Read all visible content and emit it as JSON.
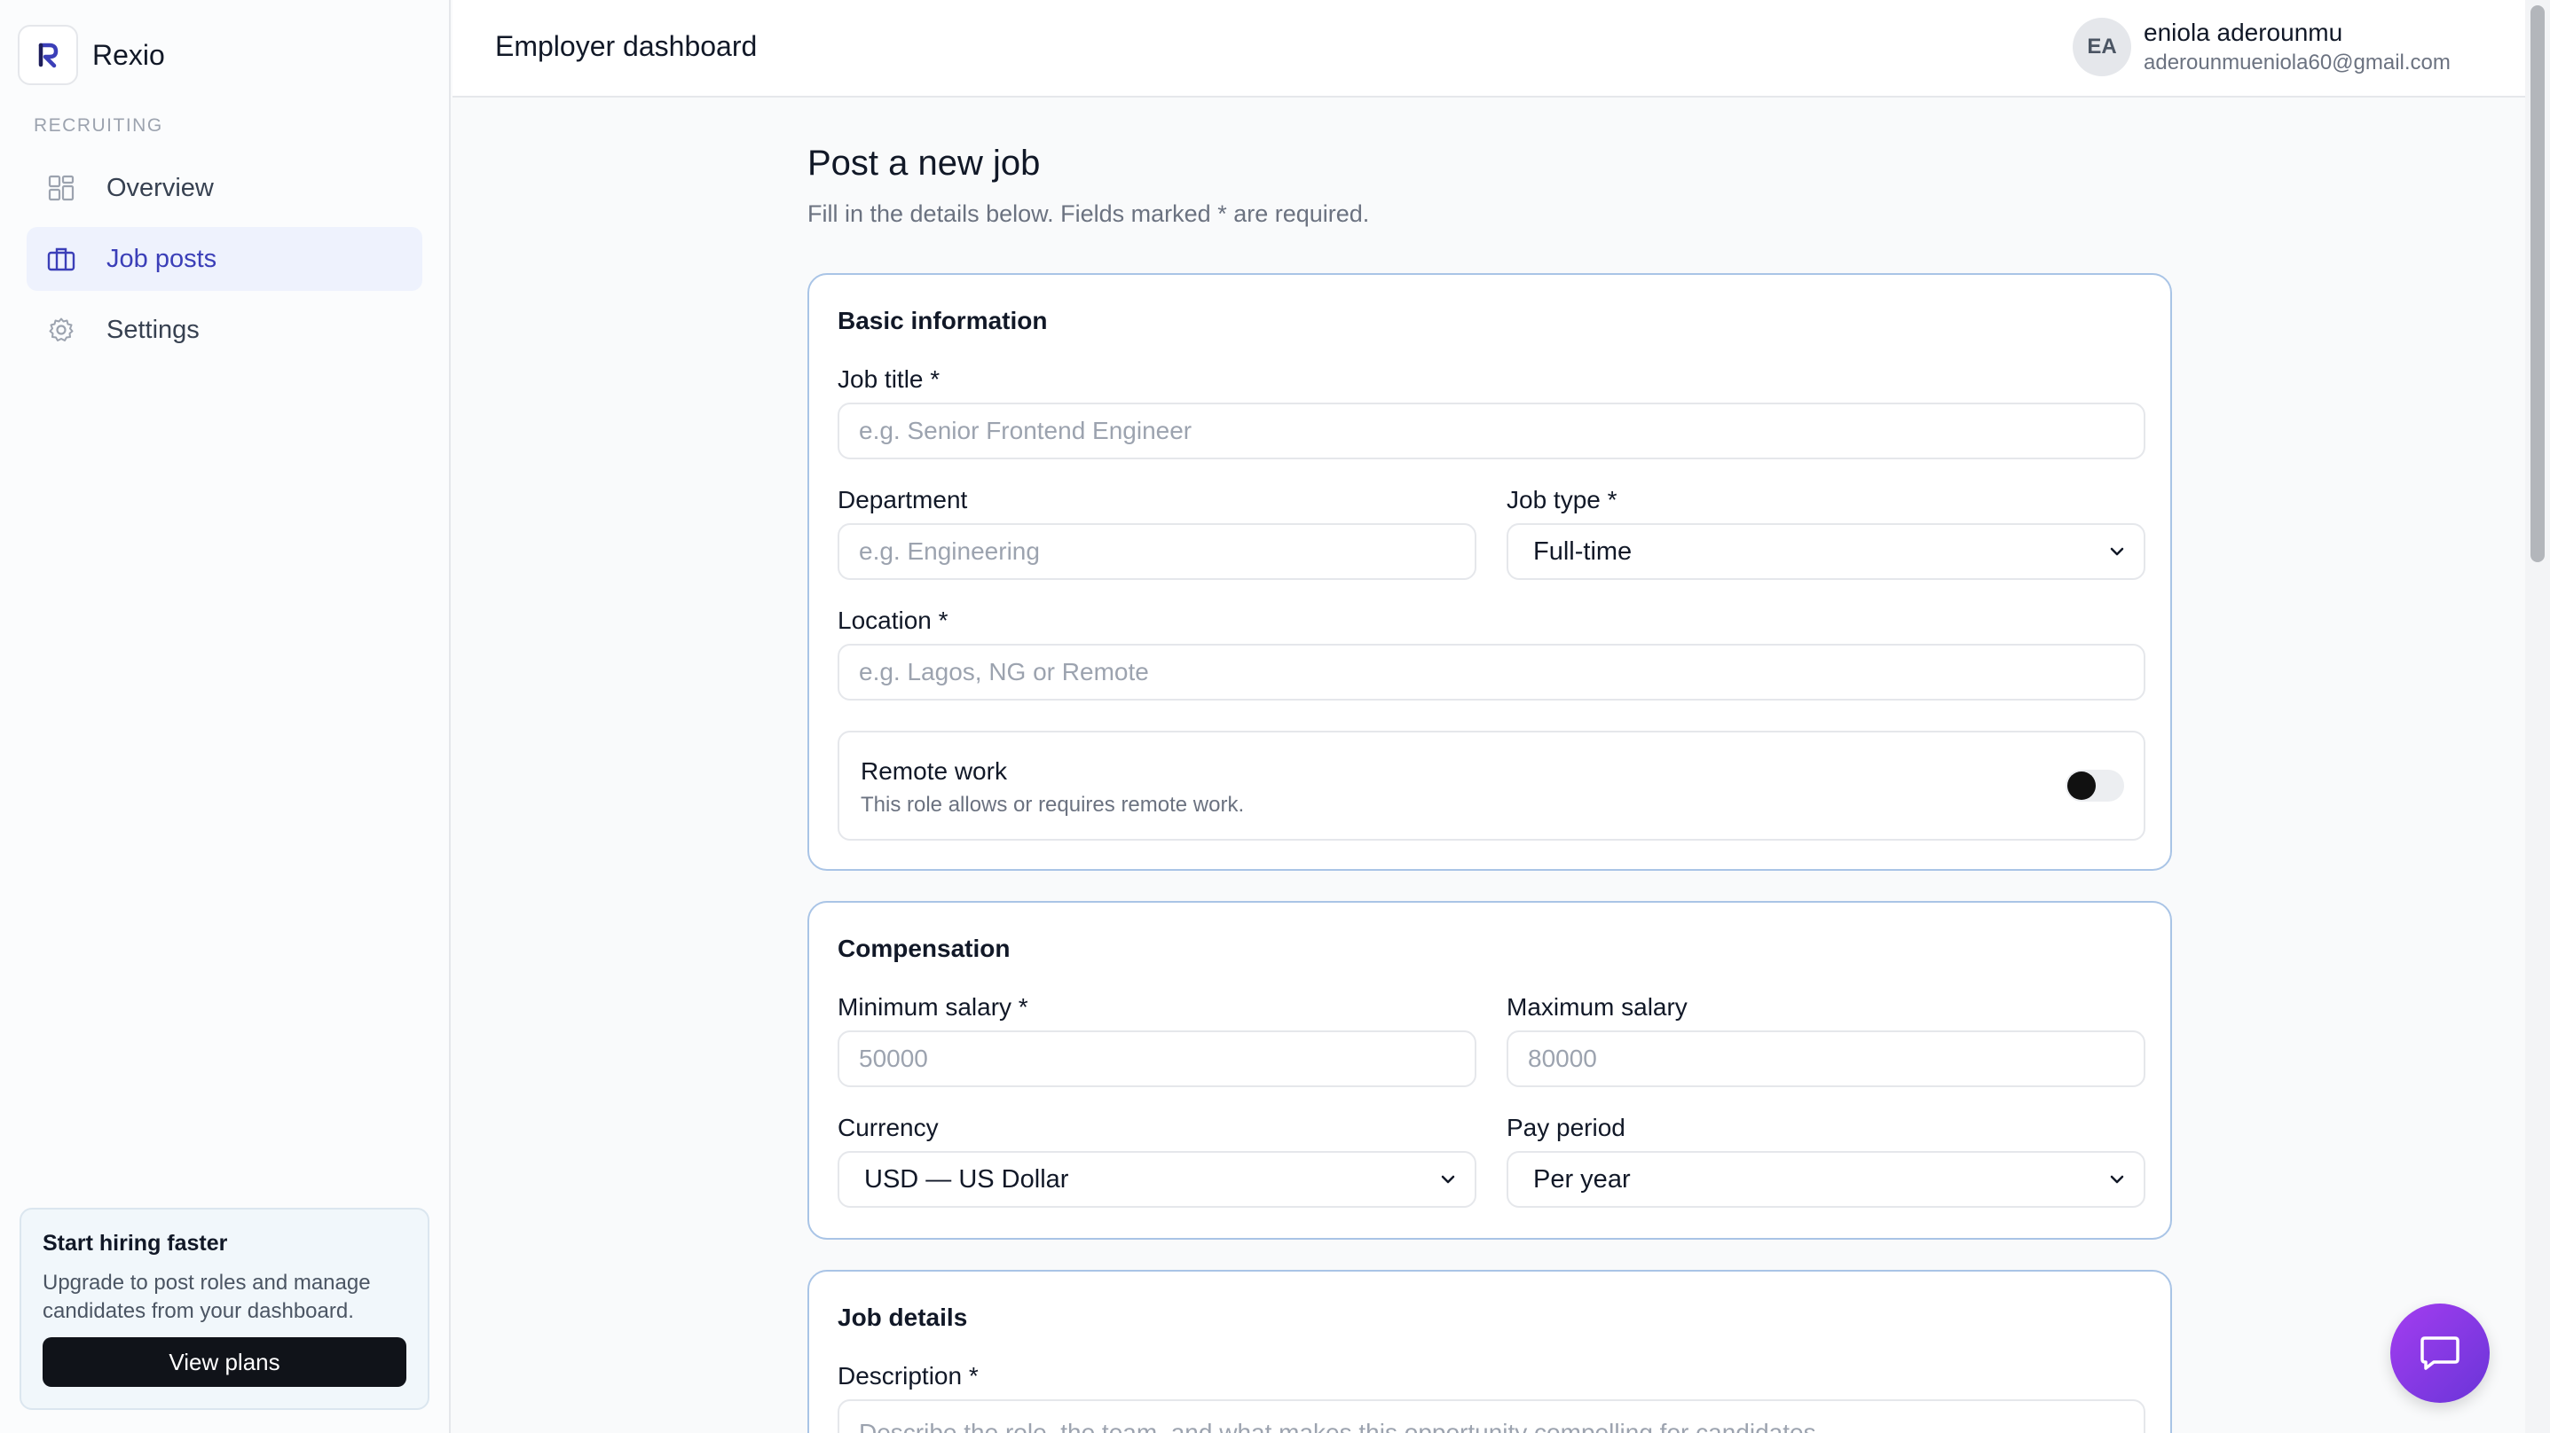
{
  "brand": {
    "name": "Rexio",
    "logo_letter": "R"
  },
  "sidebar": {
    "section_label": "RECRUITING",
    "items": [
      {
        "label": "Overview",
        "icon": "grid-icon",
        "active": false
      },
      {
        "label": "Job posts",
        "icon": "briefcase-icon",
        "active": true
      },
      {
        "label": "Settings",
        "icon": "gear-icon",
        "active": false
      }
    ],
    "promo": {
      "title": "Start hiring faster",
      "text": "Upgrade to post roles and manage candidates from your dashboard.",
      "button": "View plans"
    }
  },
  "header": {
    "title": "Employer dashboard",
    "user": {
      "initials": "EA",
      "name": "eniola aderounmu",
      "email": "aderounmueniola60@gmail.com"
    }
  },
  "page": {
    "title": "Post a new job",
    "subtitle": "Fill in the details below. Fields marked * are required."
  },
  "basic": {
    "title": "Basic information",
    "job_title_label": "Job title *",
    "job_title_placeholder": "e.g. Senior Frontend Engineer",
    "department_label": "Department",
    "department_placeholder": "e.g. Engineering",
    "job_type_label": "Job type *",
    "job_type_value": "Full-time",
    "location_label": "Location *",
    "location_placeholder": "e.g. Lagos, NG or Remote",
    "remote_title": "Remote work",
    "remote_desc": "This role allows or requires remote work.",
    "remote_enabled": false
  },
  "compensation": {
    "title": "Compensation",
    "min_label": "Minimum salary *",
    "min_placeholder": "50000",
    "max_label": "Maximum salary",
    "max_placeholder": "80000",
    "currency_label": "Currency",
    "currency_value": "USD — US Dollar",
    "period_label": "Pay period",
    "period_value": "Per year"
  },
  "details": {
    "title": "Job details",
    "description_label": "Description *",
    "description_placeholder": "Describe the role, the team, and what makes this opportunity compelling for candidates."
  },
  "colors": {
    "accent": "#3b3fb8",
    "chat": "#8b3ae6",
    "card_border": "#a9c4e6"
  }
}
